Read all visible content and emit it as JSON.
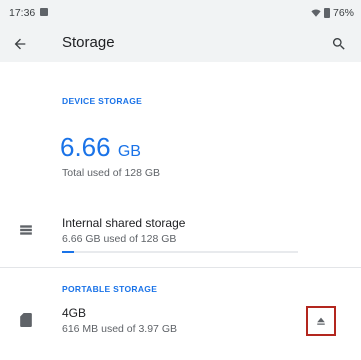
{
  "status_bar": {
    "time": "17:36",
    "battery": "76%"
  },
  "app_bar": {
    "title": "Storage"
  },
  "device_storage": {
    "header": "DEVICE STORAGE",
    "used_value": "6.66",
    "used_unit": "GB",
    "total_used_text": "Total used of 128 GB",
    "internal": {
      "title": "Internal shared storage",
      "subtitle": "6.66 GB used of 128 GB",
      "usage_fraction": 0.052
    }
  },
  "portable_storage": {
    "header": "PORTABLE STORAGE",
    "card": {
      "title": "4GB",
      "subtitle": "616 MB used of 3.97 GB"
    }
  },
  "colors": {
    "accent": "#1a73e8",
    "highlight_border": "#b3261e"
  }
}
